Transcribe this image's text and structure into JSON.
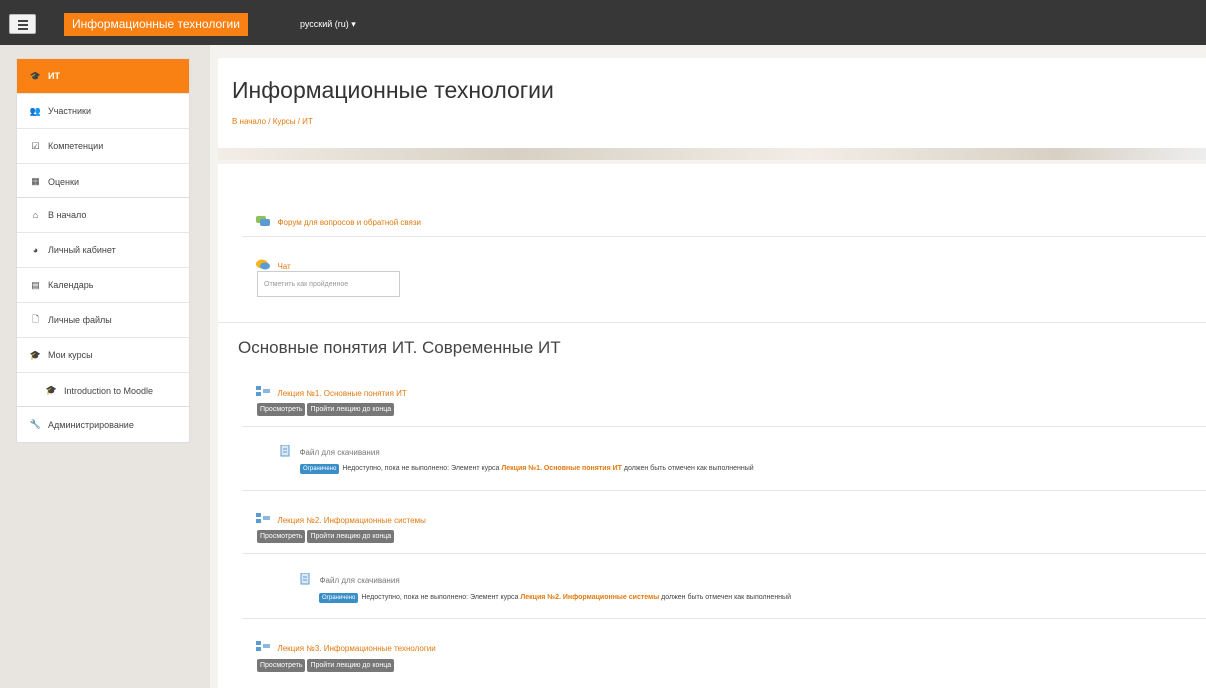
{
  "navbar": {
    "site_name": "Информационные технологии",
    "language": "русский (ru) ▾"
  },
  "sidebar": {
    "course_items": [
      {
        "icon": "graduation-cap-icon",
        "label": "ИТ"
      },
      {
        "icon": "users-icon",
        "label": "Участники"
      },
      {
        "icon": "checkbox-icon",
        "label": "Компетенции"
      },
      {
        "icon": "table-icon",
        "label": "Оценки"
      }
    ],
    "main_items": [
      {
        "icon": "home-icon",
        "label": "В начало"
      },
      {
        "icon": "dashboard-icon",
        "label": "Личный кабинет"
      },
      {
        "icon": "calendar-icon",
        "label": "Календарь"
      },
      {
        "icon": "file-icon",
        "label": "Личные файлы"
      },
      {
        "icon": "graduation-cap-icon",
        "label": "Мои курсы"
      },
      {
        "icon": "graduation-cap-icon",
        "label": "Introduction to Moodle"
      }
    ],
    "admin_item": {
      "icon": "wrench-icon",
      "label": "Администрирование"
    }
  },
  "header": {
    "title": "Информационные технологии",
    "breadcrumb": "В начало / Курсы / ИТ"
  },
  "content": {
    "forum_link": "Форум для вопросов и обратной связи",
    "chat_link": "Чат",
    "mark_complete_button": "Отметить как пройденное",
    "section_title": "Основные понятия ИТ. Современные ИТ",
    "view_button": "Просмотреть",
    "finish_button": "Пройти лекцию до конца",
    "lessons": [
      {
        "title": "Лекция №1. Основные понятия ИТ"
      },
      {
        "title": "Лекция №2. Информационные системы"
      },
      {
        "title": "Лекция №3. Информационные технологии"
      }
    ],
    "files": [
      {
        "title": "Файл для скачивания",
        "badge": "Ограничено",
        "text_before": "Недоступно, пока не выполнено: Элемент курса",
        "link": "Лекция №1. Основные понятия ИТ",
        "text_after": "должен быть отмечен как выполненный"
      },
      {
        "title": "Файл для скачивания",
        "badge": "Ограничено",
        "text_before": "Недоступно, пока не выполнено: Элемент курса",
        "link": "Лекция №2. Информационные системы",
        "text_after": "должен быть отмечен как выполненный"
      }
    ]
  },
  "colors": {
    "accent": "#f98012",
    "navbar": "#373737",
    "link": "#e07a10",
    "badge": "#3a8fc9",
    "button": "#777777"
  }
}
